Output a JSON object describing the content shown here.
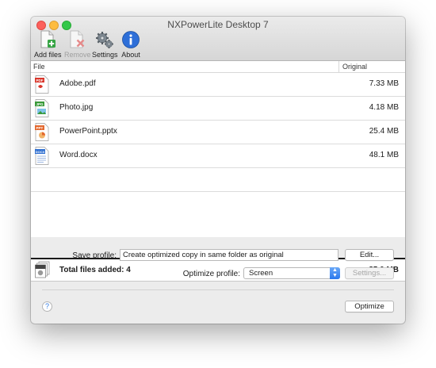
{
  "window": {
    "title": "NXPowerLite Desktop 7"
  },
  "toolbar": [
    {
      "label": "Add files",
      "icon": "add-files-icon",
      "enabled": true
    },
    {
      "label": "Remove",
      "icon": "remove-icon",
      "enabled": false
    },
    {
      "label": "Settings",
      "icon": "gear-icon",
      "enabled": true
    },
    {
      "label": "About",
      "icon": "info-icon",
      "enabled": true
    }
  ],
  "list": {
    "columns": {
      "file": "File",
      "original": "Original"
    },
    "files": [
      {
        "name": "Adobe.pdf",
        "size": "7.33 MB",
        "badge": "PDF",
        "color": "#d9362b"
      },
      {
        "name": "Photo.jpg",
        "size": "4.18 MB",
        "badge": "JPG",
        "color": "#3a9a3a"
      },
      {
        "name": "PowerPoint.pptx",
        "size": "25.4 MB",
        "badge": "PPT",
        "color": "#e3672d"
      },
      {
        "name": "Word.docx",
        "size": "48.1 MB",
        "badge": "DOCX",
        "color": "#2f6fd0"
      }
    ]
  },
  "total": {
    "label": "Total files added: 4",
    "size": "85.0 MB"
  },
  "save_profile": {
    "label": "Save profile:",
    "value": "Create optimized copy in same folder as original",
    "edit_button": "Edit..."
  },
  "optimize_profile": {
    "label": "Optimize profile:",
    "value": "Screen",
    "settings_button": "Settings..."
  },
  "help_button": "?",
  "optimize_button": "Optimize"
}
